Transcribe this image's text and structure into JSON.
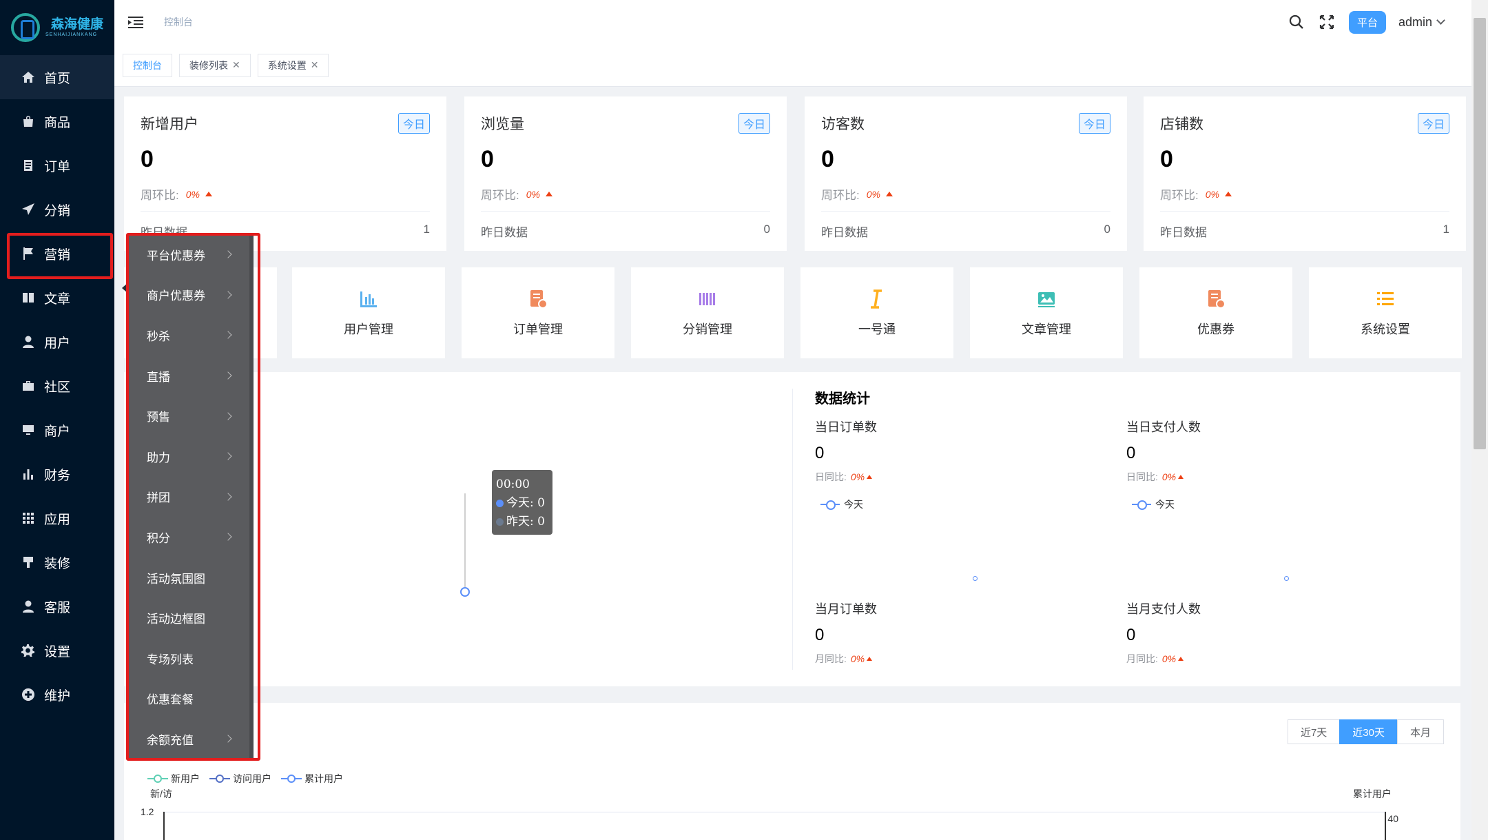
{
  "app": {
    "logo_text": "森海健康",
    "logo_sub": "SENHAIJIANKANG"
  },
  "sidebar": {
    "items": [
      {
        "label": "首页",
        "icon": "home-icon"
      },
      {
        "label": "商品",
        "icon": "bag-icon"
      },
      {
        "label": "订单",
        "icon": "order-icon"
      },
      {
        "label": "分销",
        "icon": "send-icon"
      },
      {
        "label": "营销",
        "icon": "flag-icon"
      },
      {
        "label": "文章",
        "icon": "book-icon"
      },
      {
        "label": "用户",
        "icon": "user-icon"
      },
      {
        "label": "社区",
        "icon": "briefcase-icon"
      },
      {
        "label": "商户",
        "icon": "monitor-icon"
      },
      {
        "label": "财务",
        "icon": "bar-chart-icon"
      },
      {
        "label": "应用",
        "icon": "grid-icon"
      },
      {
        "label": "装修",
        "icon": "brush-icon"
      },
      {
        "label": "客服",
        "icon": "user-tie-icon"
      },
      {
        "label": "设置",
        "icon": "gear-icon"
      },
      {
        "label": "维护",
        "icon": "plus-circle-icon"
      }
    ],
    "active_index": 0
  },
  "topbar": {
    "breadcrumb": "控制台",
    "platform_label": "平台",
    "user": "admin"
  },
  "tags": [
    {
      "label": "控制台",
      "closable": false
    },
    {
      "label": "装修列表",
      "closable": true
    },
    {
      "label": "系统设置",
      "closable": true
    }
  ],
  "stats": [
    {
      "title": "新增用户",
      "badge": "今日",
      "value": "0",
      "ratio_label": "周环比:",
      "ratio": "0%",
      "foot_label": "昨日数据",
      "foot_value": "1"
    },
    {
      "title": "浏览量",
      "badge": "今日",
      "value": "0",
      "ratio_label": "周环比:",
      "ratio": "0%",
      "foot_label": "昨日数据",
      "foot_value": "0"
    },
    {
      "title": "访客数",
      "badge": "今日",
      "value": "0",
      "ratio_label": "周环比:",
      "ratio": "0%",
      "foot_label": "昨日数据",
      "foot_value": "0"
    },
    {
      "title": "店铺数",
      "badge": "今日",
      "value": "0",
      "ratio_label": "周环比:",
      "ratio": "0%",
      "foot_label": "昨日数据",
      "foot_value": "1"
    }
  ],
  "quick_links": [
    {
      "label": "用户管理",
      "color": "#5ab1ef"
    },
    {
      "label": "订单管理",
      "color": "#f08a5d"
    },
    {
      "label": "分销管理",
      "color": "#a77ce8"
    },
    {
      "label": "一号通",
      "color": "#ffb01f"
    },
    {
      "label": "文章管理",
      "color": "#3dbeb5"
    },
    {
      "label": "优惠券",
      "color": "#f08a5d"
    },
    {
      "label": "系统设置",
      "color": "#ffa600"
    }
  ],
  "data_stats": {
    "title": "数据统计",
    "blocks": [
      {
        "label": "当日订单数",
        "value": "0",
        "ratio_label": "日同比:",
        "ratio": "0%",
        "legend": "今天"
      },
      {
        "label": "当日支付人数",
        "value": "0",
        "ratio_label": "日同比:",
        "ratio": "0%",
        "legend": "今天"
      },
      {
        "label": "当月订单数",
        "value": "0",
        "ratio_label": "月同比:",
        "ratio": "0%"
      },
      {
        "label": "当月支付人数",
        "value": "0",
        "ratio_label": "月同比:",
        "ratio": "0%"
      }
    ]
  },
  "tooltip": {
    "time": "00:00",
    "today": "今天: 0",
    "yesterday": "昨天: 0",
    "today_color": "#5b8ff9",
    "yesterday_color": "#6b7a8f"
  },
  "user_chart": {
    "ranges": [
      "近7天",
      "近30天",
      "本月"
    ],
    "active_range": "近30天",
    "legend": [
      {
        "name": "新用户",
        "color": "#5fd0b5"
      },
      {
        "name": "访问用户",
        "color": "#5470c6"
      },
      {
        "name": "累计用户",
        "color": "#5b8ff9"
      }
    ],
    "left_axis_name": "新/访",
    "right_axis_name": "累计用户",
    "left_top_tick": "1.2",
    "right_top_tick": "40"
  },
  "submenu": {
    "items": [
      {
        "label": "平台优惠券",
        "has_children": true
      },
      {
        "label": "商户优惠券",
        "has_children": true
      },
      {
        "label": "秒杀",
        "has_children": true
      },
      {
        "label": "直播",
        "has_children": true
      },
      {
        "label": "预售",
        "has_children": true
      },
      {
        "label": "助力",
        "has_children": true
      },
      {
        "label": "拼团",
        "has_children": true
      },
      {
        "label": "积分",
        "has_children": true
      },
      {
        "label": "活动氛围图",
        "has_children": false
      },
      {
        "label": "活动边框图",
        "has_children": false
      },
      {
        "label": "专场列表",
        "has_children": false
      },
      {
        "label": "优惠套餐",
        "has_children": false
      },
      {
        "label": "余额充值",
        "has_children": true
      }
    ]
  }
}
